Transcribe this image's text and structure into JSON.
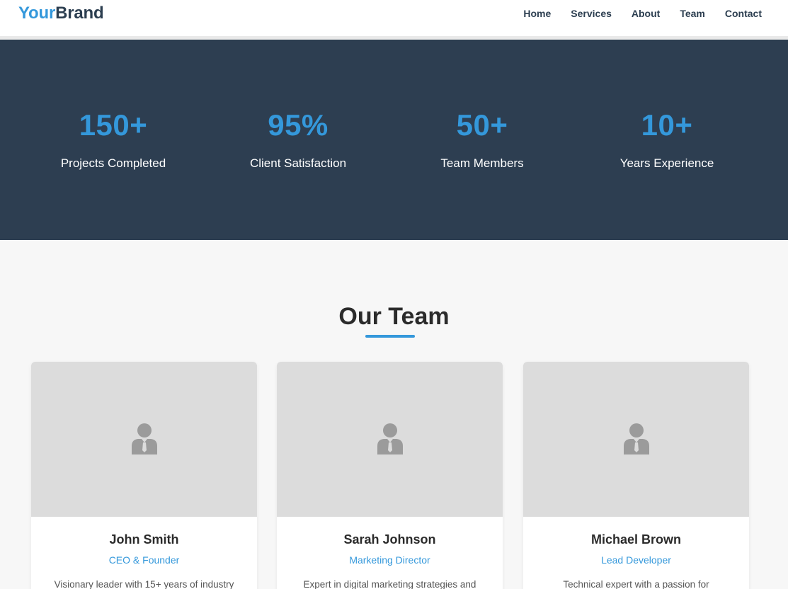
{
  "brand": {
    "part1": "Your",
    "part2": "Brand"
  },
  "nav": [
    {
      "label": "Home"
    },
    {
      "label": "Services"
    },
    {
      "label": "About"
    },
    {
      "label": "Team"
    },
    {
      "label": "Contact"
    }
  ],
  "stats": [
    {
      "value": "150+",
      "label": "Projects Completed"
    },
    {
      "value": "95%",
      "label": "Client Satisfaction"
    },
    {
      "value": "50+",
      "label": "Team Members"
    },
    {
      "value": "10+",
      "label": "Years Experience"
    }
  ],
  "team": {
    "title": "Our Team",
    "members": [
      {
        "name": "John Smith",
        "role": "CEO & Founder",
        "bio": "Visionary leader with 15+ years of industry"
      },
      {
        "name": "Sarah Johnson",
        "role": "Marketing Director",
        "bio": "Expert in digital marketing strategies and"
      },
      {
        "name": "Michael Brown",
        "role": "Lead Developer",
        "bio": "Technical expert with a passion for"
      }
    ]
  },
  "colors": {
    "accent": "#3498db",
    "dark": "#2c3e50",
    "stats_bg": "#2d3e51",
    "page_bg": "#f7f7f7",
    "photo_bg": "#dcdcdc"
  },
  "icons": {
    "avatar": "user-avatar-icon"
  }
}
